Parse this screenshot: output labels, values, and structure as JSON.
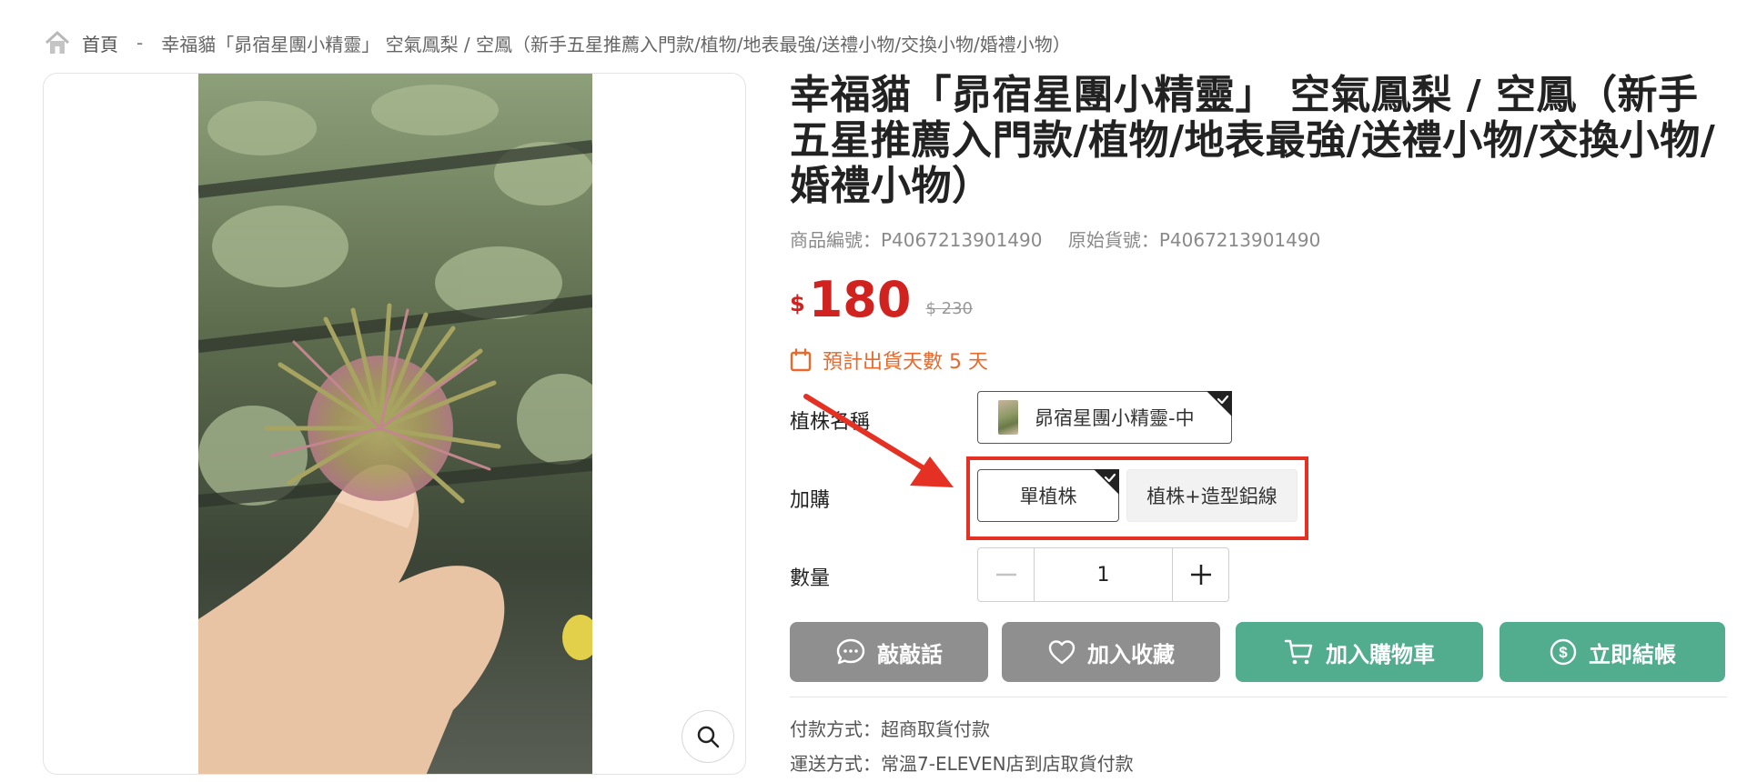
{
  "breadcrumb": {
    "home_label": "首頁",
    "separator": "-",
    "current": "幸福貓「昴宿星團小精靈」 空氣鳳梨 / 空鳳（新手五星推薦入門款/植物/地表最強/送禮小物/交換小物/婚禮小物）"
  },
  "product": {
    "title": "幸福貓「昴宿星團小精靈」 空氣鳳梨 / 空鳳（新手五星推薦入門款/植物/地表最強/送禮小物/交換小物/婚禮小物）",
    "item_no": "商品編號：P4067213901490",
    "original_no": "原始貨號：P4067213901490",
    "currency": "$",
    "price": "180",
    "original_price": "$ 230",
    "ship_days": "預計出貨天數 5 天"
  },
  "options": {
    "plant_label": "植株名稱",
    "plant_value": "昴宿星團小精靈-中",
    "addon_label": "加購",
    "addon_choices": [
      "單植株",
      "植株+造型鋁線"
    ],
    "qty_label": "數量",
    "qty_value": "1"
  },
  "actions": {
    "chat": "敲敲話",
    "favorite": "加入收藏",
    "cart": "加入購物車",
    "checkout": "立即結帳"
  },
  "info": {
    "payment": "付款方式：超商取貨付款",
    "shipping": "運送方式：常溫7-ELEVEN店到店取貨付款"
  },
  "colors": {
    "price_red": "#d0231f",
    "accent_orange": "#e8692b",
    "action_green": "#52ad8e",
    "action_gray": "#8f8f8f",
    "annotation_red": "#e53124"
  },
  "icons": [
    "home-icon",
    "magnifier-icon",
    "calendar-icon",
    "check-corner-icon",
    "minus-icon",
    "plus-icon",
    "chat-bubble-icon",
    "heart-icon",
    "cart-icon",
    "dollar-circle-icon"
  ]
}
